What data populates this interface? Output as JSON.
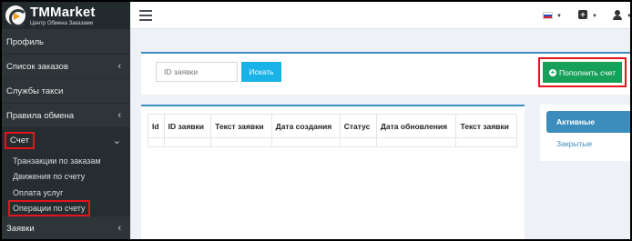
{
  "brand": {
    "title": "TMMarket",
    "subtitle": "Центр Обмена Заказами"
  },
  "sidebar": {
    "items": [
      {
        "label": "Профиль"
      },
      {
        "label": "Список заказов"
      },
      {
        "label": "Службы такси"
      },
      {
        "label": "Правила обмена"
      },
      {
        "label": "Счет"
      },
      {
        "label": "Заявки"
      }
    ],
    "sub_items": [
      {
        "label": "Транзакции по заказам"
      },
      {
        "label": "Движения по счету"
      },
      {
        "label": "Оплата услуг"
      },
      {
        "label": "Операции по счету"
      }
    ]
  },
  "search": {
    "placeholder": "ID заявки",
    "button_label": "Искать"
  },
  "actions": {
    "topup_label": "Пополнить счет"
  },
  "table": {
    "columns": [
      "Id",
      "ID заявки",
      "Текст заявки",
      "Дата создания",
      "Статус",
      "Дата обновления",
      "Текст заявки"
    ]
  },
  "filters": {
    "active_label": "Активные",
    "closed_label": "Закрытые"
  },
  "colors": {
    "accent": "#3c8dbc",
    "success": "#17a05a",
    "info": "#1ab3e8",
    "highlight": "#e4141e",
    "sidebar": "#2d3539"
  }
}
